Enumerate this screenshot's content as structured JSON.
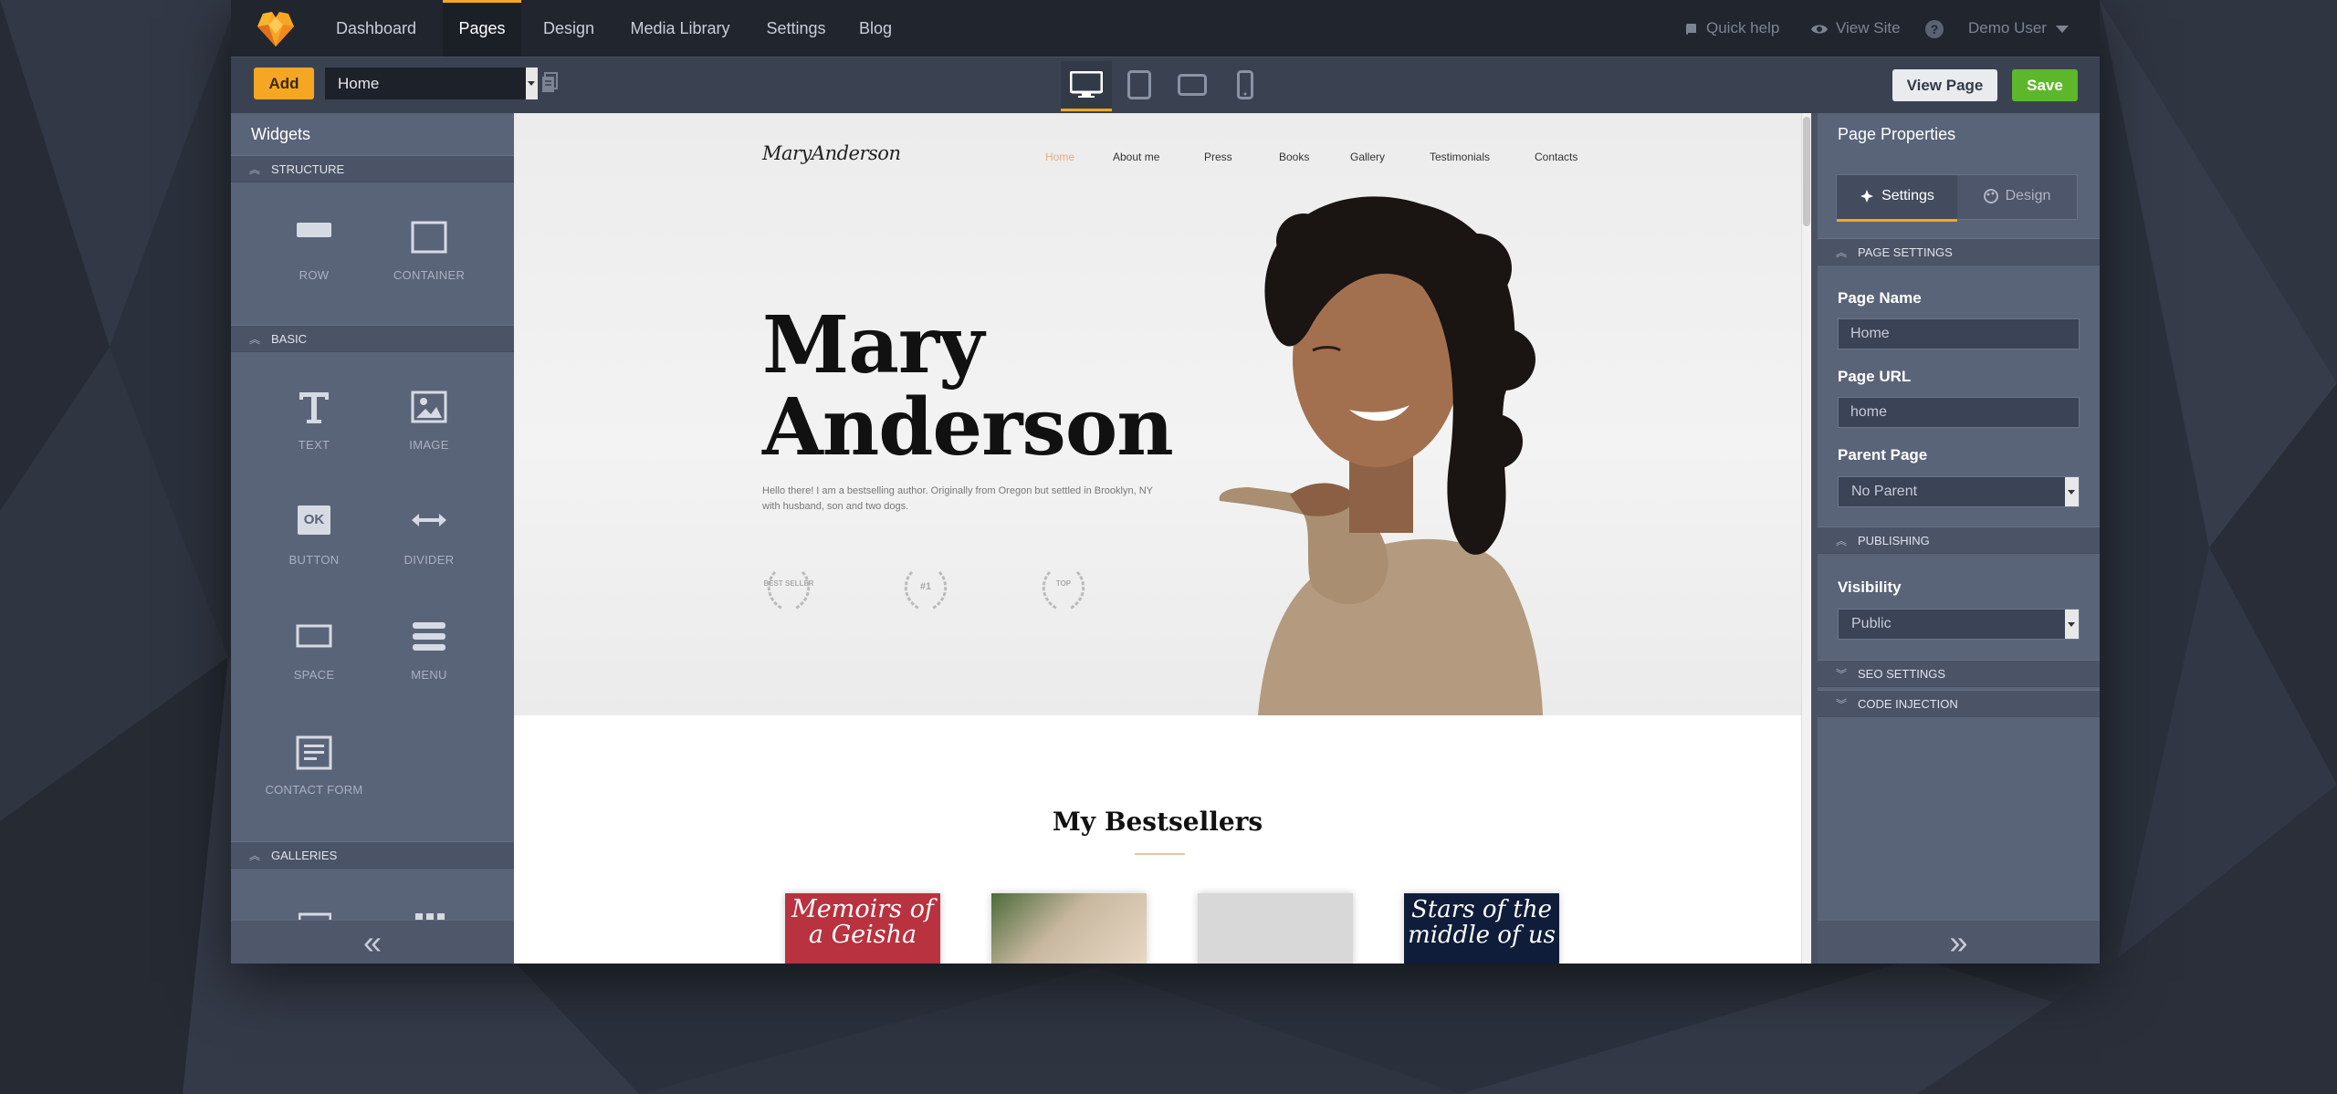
{
  "topnav": {
    "items": [
      {
        "label": "Dashboard",
        "active": false
      },
      {
        "label": "Pages",
        "active": true
      },
      {
        "label": "Design",
        "active": false
      },
      {
        "label": "Media Library",
        "active": false
      },
      {
        "label": "Settings",
        "active": false
      },
      {
        "label": "Blog",
        "active": false
      }
    ],
    "quick_help": "Quick help",
    "view_site": "View Site",
    "user": "Demo User"
  },
  "toolbar": {
    "add_label": "Add",
    "page_select_value": "Home",
    "devices": [
      "desktop-icon",
      "tablet-icon",
      "tablet-landscape-icon",
      "phone-icon"
    ],
    "active_device": "desktop",
    "view_page_label": "View Page",
    "save_label": "Save"
  },
  "widgets": {
    "title": "Widgets",
    "sections": [
      {
        "label": "STRUCTURE",
        "items": [
          {
            "label": "ROW",
            "icon": "row-icon"
          },
          {
            "label": "CONTAINER",
            "icon": "container-icon"
          }
        ]
      },
      {
        "label": "BASIC",
        "items": [
          {
            "label": "TEXT",
            "icon": "text-icon"
          },
          {
            "label": "IMAGE",
            "icon": "image-icon"
          },
          {
            "label": "BUTTON",
            "icon": "button-icon",
            "glyph": "OK"
          },
          {
            "label": "DIVIDER",
            "icon": "divider-icon"
          },
          {
            "label": "SPACE",
            "icon": "space-icon"
          },
          {
            "label": "MENU",
            "icon": "menu-icon"
          },
          {
            "label": "CONTACT FORM",
            "icon": "contact-form-icon"
          }
        ]
      },
      {
        "label": "GALLERIES",
        "items": []
      }
    ]
  },
  "site": {
    "logo": "MaryAnderson",
    "menu": [
      "Home",
      "About me",
      "Press",
      "Books",
      "Gallery",
      "Testimonials",
      "Contacts"
    ],
    "hero_title_line1": "Mary",
    "hero_title_line2": "Anderson",
    "hero_text": "Hello there! I am a bestselling author. Originally from Oregon but settled in Brooklyn, NY with husband, son and two dogs.",
    "awards": [
      "BEST SELLER",
      "#1",
      "TOP"
    ],
    "bestsellers_title": "My Bestsellers",
    "books": [
      {
        "title": "Memoirs of a Geisha",
        "color": "#b8323f"
      },
      {
        "title": "",
        "color": "#c9b8a0"
      },
      {
        "title": "",
        "color": "#d8d8d8"
      },
      {
        "title": "Stars of the middle of us",
        "color": "#0f1d3a"
      }
    ]
  },
  "properties": {
    "title": "Page Properties",
    "tabs": [
      {
        "label": "Settings",
        "active": true
      },
      {
        "label": "Design",
        "active": false
      }
    ],
    "page_settings_label": "PAGE SETTINGS",
    "page_name_label": "Page Name",
    "page_name_value": "Home",
    "page_url_label": "Page URL",
    "page_url_value": "home",
    "parent_page_label": "Parent Page",
    "parent_page_value": "No Parent",
    "publishing_label": "PUBLISHING",
    "visibility_label": "Visibility",
    "visibility_value": "Public",
    "seo_label": "SEO SETTINGS",
    "code_injection_label": "CODE INJECTION"
  },
  "colors": {
    "accent": "#f5a623",
    "save": "#5cb82a",
    "panel": "#5a6479",
    "nav": "#21252e"
  }
}
